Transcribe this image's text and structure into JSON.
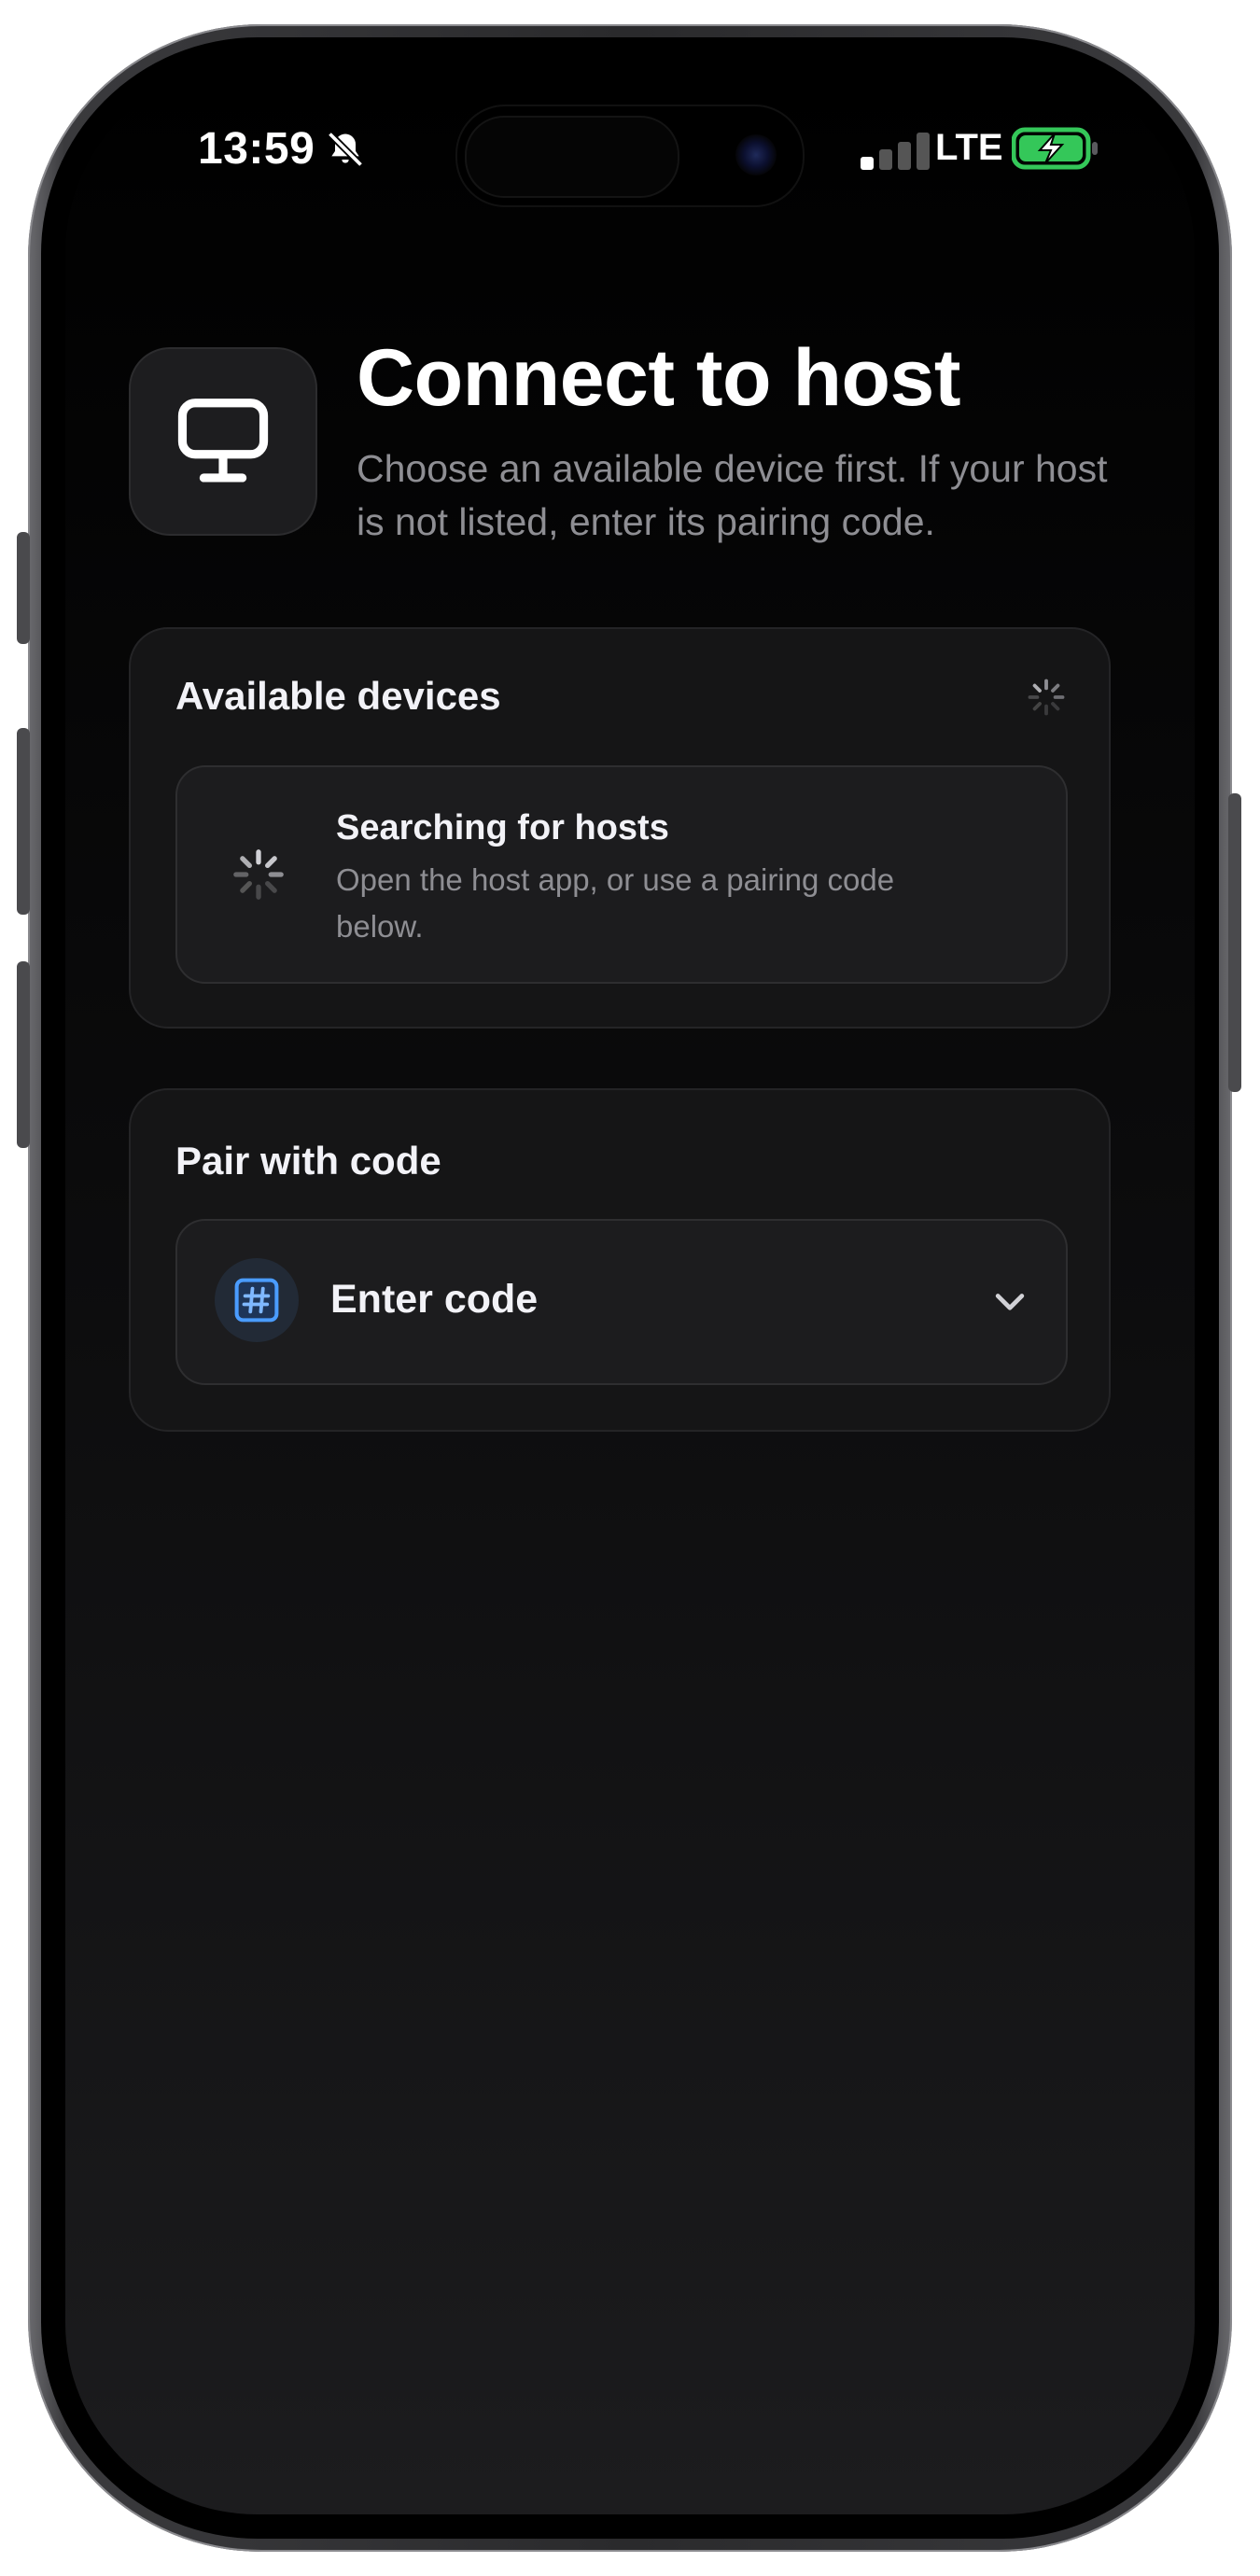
{
  "status_bar": {
    "time": "13:59",
    "network": "LTE",
    "icons": [
      "bell-slash-icon",
      "cellular-signal-icon",
      "battery-charging-icon"
    ]
  },
  "header": {
    "icon": "monitor-icon",
    "title": "Connect to host",
    "subtitle": "Choose an available device first. If your host is not listed, enter its pairing code."
  },
  "available_devices": {
    "title": "Available devices",
    "status_title": "Searching for hosts",
    "status_subtitle": "Open the host app, or use a pairing code below."
  },
  "pair_with_code": {
    "title": "Pair with code",
    "field_label": "Enter code",
    "icon": "hash-icon"
  },
  "colors": {
    "accent": "#4a9cff",
    "background": "#000000",
    "card": "#151516",
    "secondary_text": "#8e8e93"
  }
}
